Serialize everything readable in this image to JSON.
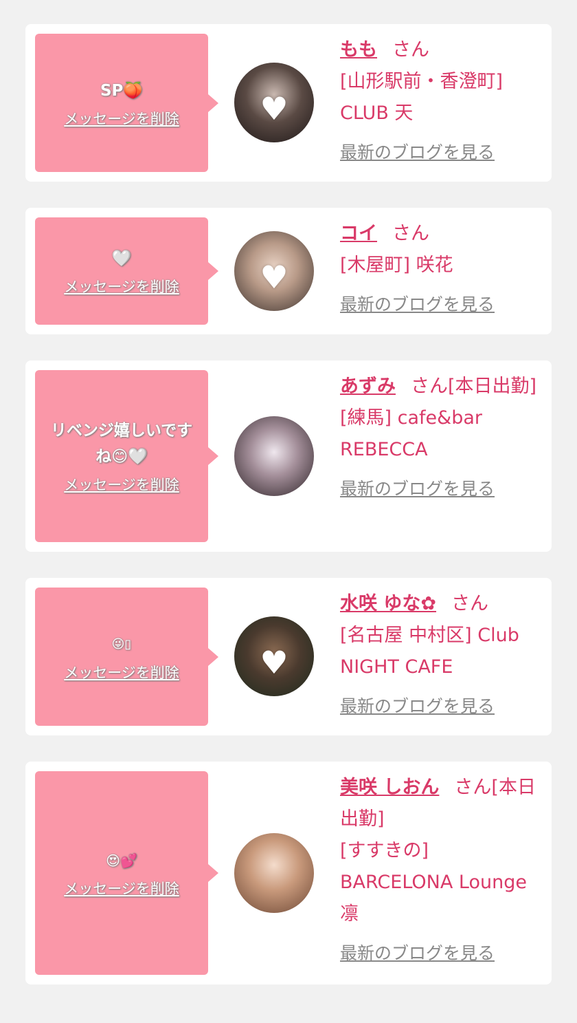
{
  "delete_label": "メッセージを削除",
  "blog_label": "最新のブログを見る",
  "honorific": "さん",
  "cards": [
    {
      "message": "SP🍑",
      "name": "もも",
      "suffix": "",
      "shop": "[山形駅前・香澄町] CLUB 天"
    },
    {
      "message": "🤍",
      "name": "コイ",
      "suffix": "",
      "shop": "[木屋町] 咲花"
    },
    {
      "message": "リベンジ嬉しいですね😊🤍",
      "name": "あずみ",
      "suffix": "[本日出勤]",
      "shop": "[練馬] cafe&bar REBECCA"
    },
    {
      "message": "😜▯",
      "name": "水咲 ゆな✿",
      "suffix": "",
      "shop": "[名古屋 中村区] Club NIGHT CAFE"
    },
    {
      "message": "😍💕",
      "name": "美咲 しおん",
      "suffix": "[本日出勤]",
      "shop": "[すすきの] BARCELONA Lounge 凛"
    }
  ],
  "colors": {
    "bubble": "#fa97a8",
    "accent": "#d93a68",
    "link_gray": "#888888",
    "background": "#f1f1f1"
  }
}
